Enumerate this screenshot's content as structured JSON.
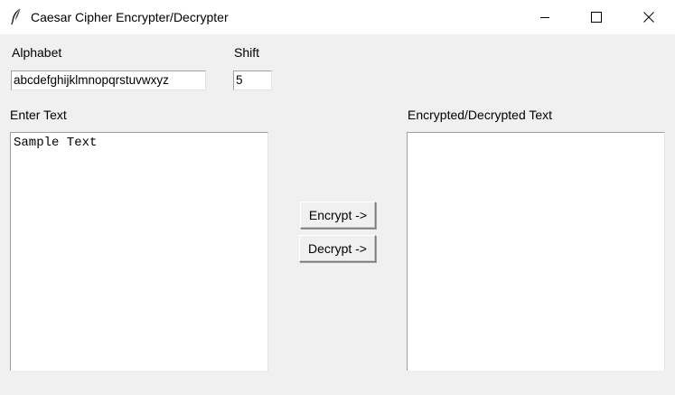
{
  "window": {
    "title": "Caesar Cipher Encrypter/Decrypter",
    "icon": "feather-icon",
    "controls": [
      "minimize-icon",
      "maximize-icon",
      "close-icon"
    ]
  },
  "alphabet": {
    "label": "Alphabet",
    "value": "abcdefghijklmnopqrstuvwxyz"
  },
  "shift": {
    "label": "Shift",
    "value": "5"
  },
  "input": {
    "label": "Enter Text",
    "value": "Sample Text"
  },
  "output": {
    "label": "Encrypted/Decrypted Text",
    "value": ""
  },
  "buttons": {
    "encrypt": "Encrypt ->",
    "decrypt": "Decrypt ->"
  }
}
